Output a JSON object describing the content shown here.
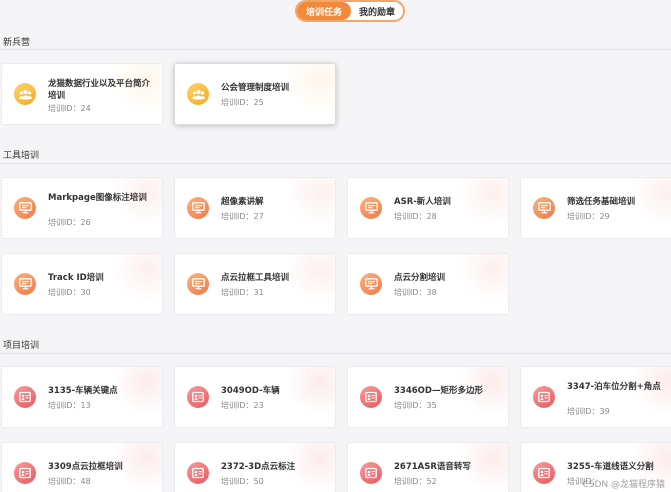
{
  "tabs": [
    {
      "label": "培训任务",
      "active": true
    },
    {
      "label": "我的勋章",
      "active": false
    }
  ],
  "sections": [
    {
      "title": "新兵营",
      "cards": [
        {
          "title": "龙猫数据行业以及平台简介培训",
          "id_label": "培训ID：24",
          "theme": "yellow",
          "icon": "users-icon"
        },
        {
          "title": "公会管理制度培训",
          "id_label": "培训ID：25",
          "theme": "yellow",
          "icon": "users-icon",
          "selected": true
        }
      ]
    },
    {
      "title": "工具培训",
      "cards": [
        {
          "title": "Markpage图像标注培训",
          "id_label": "培训ID：26",
          "theme": "orange",
          "icon": "monitor-icon"
        },
        {
          "title": "超像素讲解",
          "id_label": "培训ID：27",
          "theme": "orange",
          "icon": "monitor-icon"
        },
        {
          "title": "ASR-新人培训",
          "id_label": "培训ID：28",
          "theme": "orange",
          "icon": "monitor-icon"
        },
        {
          "title": "筛选任务基础培训",
          "id_label": "培训ID：29",
          "theme": "orange",
          "icon": "monitor-icon"
        },
        {
          "title": "Track ID培训",
          "id_label": "培训ID：30",
          "theme": "orange",
          "icon": "monitor-icon"
        },
        {
          "title": "点云拉框工具培训",
          "id_label": "培训ID：31",
          "theme": "orange",
          "icon": "monitor-icon"
        },
        {
          "title": "点云分割培训",
          "id_label": "培训ID：38",
          "theme": "orange",
          "icon": "monitor-icon"
        }
      ]
    },
    {
      "title": "项目培训",
      "cards": [
        {
          "title": "3135-车辆关键点",
          "id_label": "培训ID：13",
          "theme": "red",
          "icon": "project-icon"
        },
        {
          "title": "3049OD-车辆",
          "id_label": "培训ID：23",
          "theme": "red",
          "icon": "project-icon"
        },
        {
          "title": "3346OD—矩形多边形",
          "id_label": "培训ID：35",
          "theme": "red",
          "icon": "project-icon"
        },
        {
          "title": "3347-泊车位分割+角点",
          "id_label": "培训ID：39",
          "theme": "red",
          "icon": "project-icon"
        },
        {
          "title": "3309点云拉框培训",
          "id_label": "培训ID：48",
          "theme": "red",
          "icon": "project-icon"
        },
        {
          "title": "2372-3D点云标注",
          "id_label": "培训ID：50",
          "theme": "red",
          "icon": "project-icon"
        },
        {
          "title": "2671ASR语音转写",
          "id_label": "培训ID：52",
          "theme": "red",
          "icon": "project-icon"
        },
        {
          "title": "3255-车道线语义分割",
          "id_label": "培训ID：",
          "theme": "red",
          "icon": "project-icon"
        }
      ]
    }
  ],
  "watermark": "CSDN @龙猫程序猿"
}
